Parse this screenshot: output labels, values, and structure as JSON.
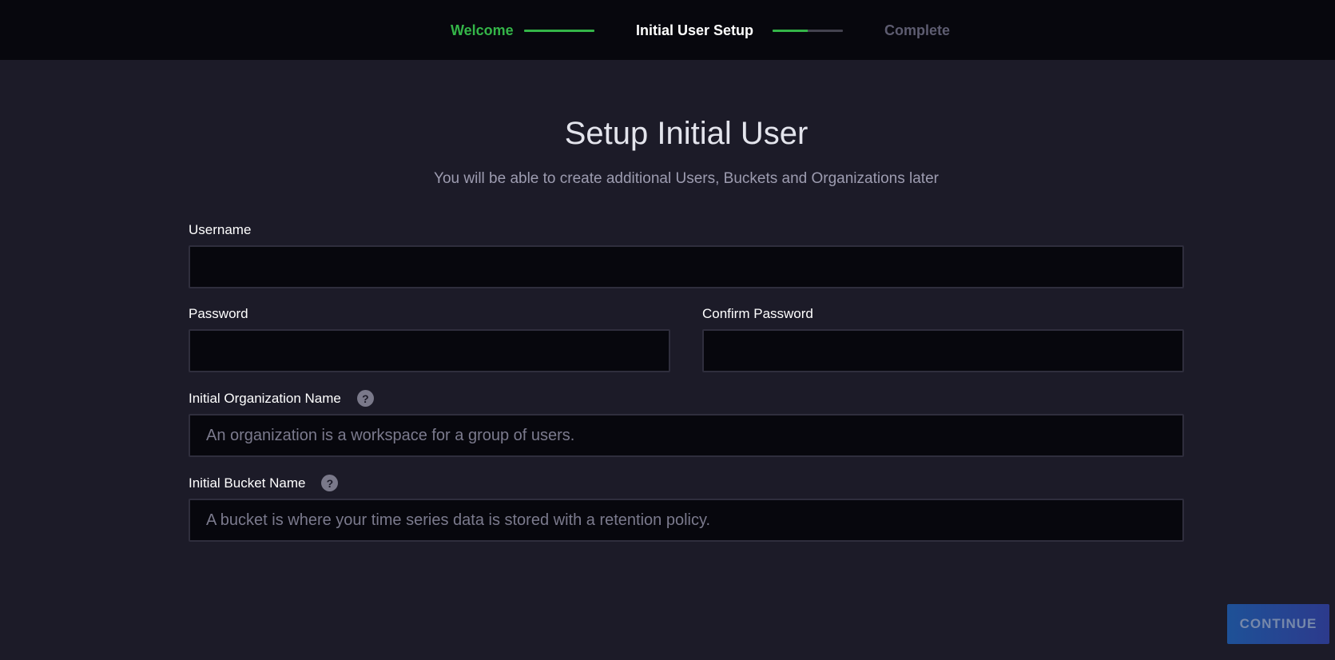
{
  "stepper": {
    "steps": [
      {
        "label": "Welcome",
        "state": "done"
      },
      {
        "label": "Initial User Setup",
        "state": "active"
      },
      {
        "label": "Complete",
        "state": "pending"
      }
    ],
    "connector_progress": [
      1.0,
      0.5
    ],
    "colors": {
      "done": "#34b548",
      "active": "#ffffff",
      "pending": "#5d5c70"
    }
  },
  "header": {
    "title": "Setup Initial User",
    "subtitle": "You will be able to create additional Users, Buckets and Organizations later"
  },
  "form": {
    "username": {
      "label": "Username",
      "value": "",
      "placeholder": ""
    },
    "password": {
      "label": "Password",
      "value": "",
      "placeholder": ""
    },
    "confirm_password": {
      "label": "Confirm Password",
      "value": "",
      "placeholder": ""
    },
    "organization": {
      "label": "Initial Organization Name",
      "value": "",
      "placeholder": "An organization is a workspace for a group of users.",
      "help_icon": "question-mark-circle-icon"
    },
    "bucket": {
      "label": "Initial Bucket Name",
      "value": "",
      "placeholder": "A bucket is where your time series data is stored with a retention policy.",
      "help_icon": "question-mark-circle-icon"
    }
  },
  "actions": {
    "continue_label": "CONTINUE",
    "continue_enabled": false
  },
  "theme": {
    "background": "#1c1b28",
    "header_bar": "#07070d",
    "input_background": "#07070d",
    "accent_green": "#34b548"
  }
}
